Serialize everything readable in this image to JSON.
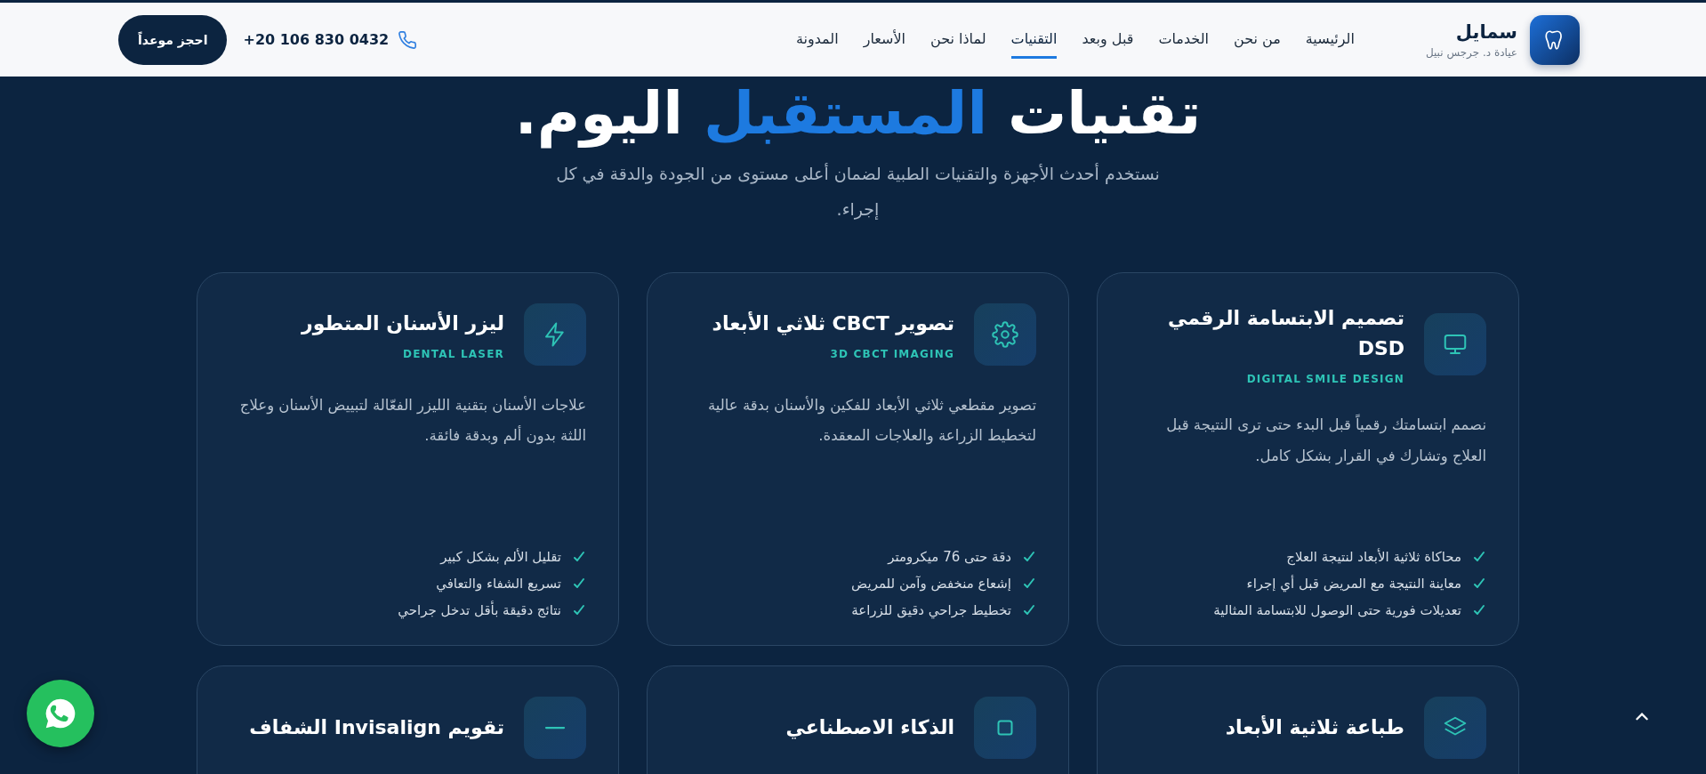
{
  "header": {
    "brand": {
      "name": "سمايل",
      "subtitle": "عيادة د. جرجس نبيل"
    },
    "nav": [
      {
        "label": "الرئيسية",
        "selected": false
      },
      {
        "label": "من نحن",
        "selected": false
      },
      {
        "label": "الخدمات",
        "selected": false
      },
      {
        "label": "قبل وبعد",
        "selected": false
      },
      {
        "label": "التقنيات",
        "selected": true
      },
      {
        "label": "لماذا نحن",
        "selected": false
      },
      {
        "label": "الأسعار",
        "selected": false
      },
      {
        "label": "المدونة",
        "selected": false
      }
    ],
    "phone": "+20 106 830 0432",
    "cta": "احجز موعداً"
  },
  "hero": {
    "title_start": "تقنيات",
    "title_highlight": "المستقبل",
    "title_end": "اليوم.",
    "subtitle": "نستخدم أحدث الأجهزة والتقنيات الطبية لضمان أعلى مستوى من الجودة والدقة في كل إجراء."
  },
  "cards": [
    {
      "title": "تصميم الابتسامة الرقمي DSD",
      "tag": "DIGITAL SMILE DESIGN",
      "description": "نصمم ابتسامتك رقمياً قبل البدء حتى ترى النتيجة قبل العلاج وتشارك في القرار بشكل كامل.",
      "features": [
        "محاكاة ثلاثية الأبعاد لنتيجة العلاج",
        "معاينة النتيجة مع المريض قبل أي إجراء",
        "تعديلات فورية حتى الوصول للابتسامة المثالية"
      ]
    },
    {
      "title": "تصوير CBCT ثلاثي الأبعاد",
      "tag": "3D CBCT IMAGING",
      "description": "تصوير مقطعي ثلاثي الأبعاد للفكين والأسنان بدقة عالية لتخطيط الزراعة والعلاجات المعقدة.",
      "features": [
        "دقة حتى 76 ميكرومتر",
        "إشعاع منخفض وآمن للمريض",
        "تخطيط جراحي دقيق للزراعة"
      ]
    },
    {
      "title": "ليزر الأسنان المتطور",
      "tag": "DENTAL LASER",
      "description": "علاجات الأسنان بتقنية الليزر الفعّالة لتبييض الأسنان وعلاج اللثة بدون ألم وبدقة فائقة.",
      "features": [
        "تقليل الألم بشكل كبير",
        "تسريع الشفاء والتعافي",
        "نتائج دقيقة بأقل تدخل جراحي"
      ]
    },
    {
      "title": "طباعة ثلاثية الأبعاد"
    },
    {
      "title": "الذكاء الاصطناعي"
    },
    {
      "title": "تقويم Invisalign الشفاف"
    }
  ]
}
